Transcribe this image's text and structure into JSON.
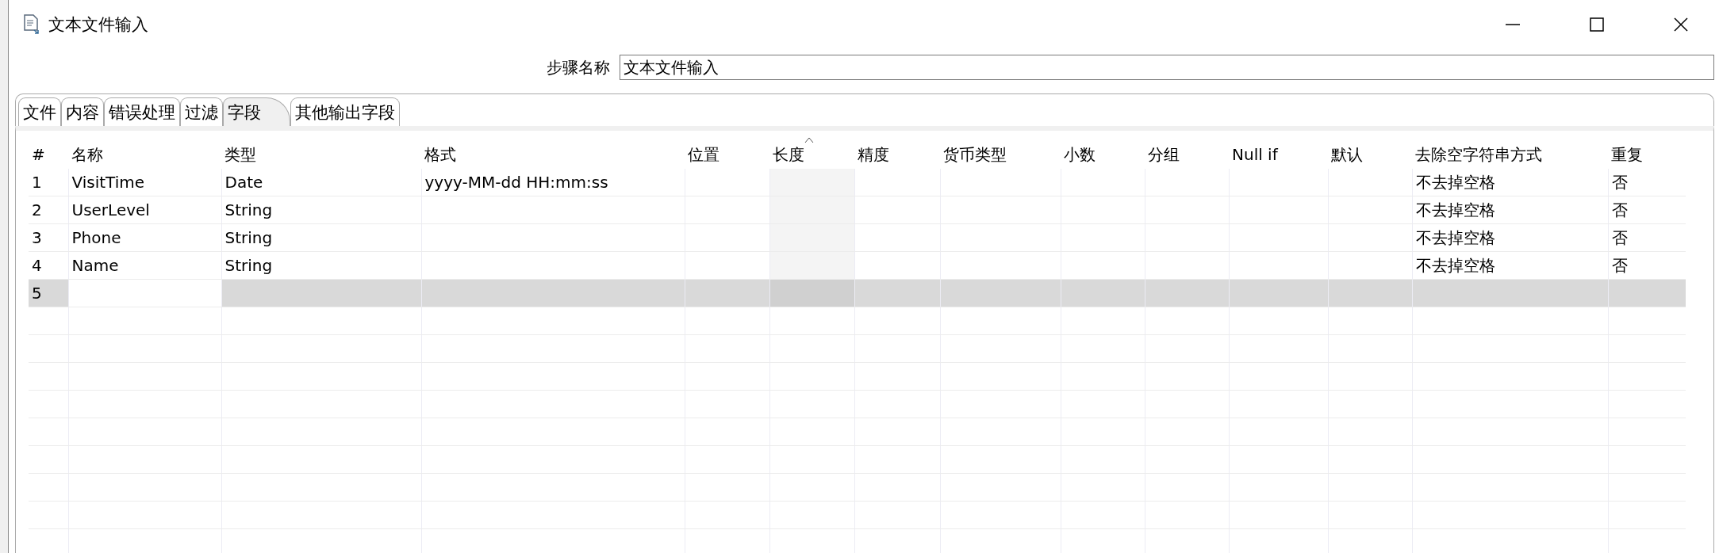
{
  "window": {
    "title": "文本文件输入"
  },
  "step_name": {
    "label": "步骤名称",
    "value": "文本文件输入"
  },
  "tabs": [
    {
      "label": "文件",
      "selected": false
    },
    {
      "label": "内容",
      "selected": false
    },
    {
      "label": "错误处理",
      "selected": false
    },
    {
      "label": "过滤",
      "selected": false
    },
    {
      "label": "字段",
      "selected": true
    },
    {
      "label": "其他输出字段",
      "selected": false
    }
  ],
  "table": {
    "columns": [
      {
        "label": "#"
      },
      {
        "label": "名称"
      },
      {
        "label": "类型"
      },
      {
        "label": "格式"
      },
      {
        "label": "位置"
      },
      {
        "label": "长度",
        "sorted": true
      },
      {
        "label": "精度"
      },
      {
        "label": "货币类型"
      },
      {
        "label": "小数"
      },
      {
        "label": "分组"
      },
      {
        "label": "Null if"
      },
      {
        "label": "默认"
      },
      {
        "label": "去除空字符串方式"
      },
      {
        "label": "重复"
      }
    ],
    "rows": [
      {
        "selected": false,
        "cells": [
          "1",
          "VisitTime",
          "Date",
          "yyyy-MM-dd HH:mm:ss",
          "",
          "",
          "",
          "",
          "",
          "",
          "",
          "",
          "不去掉空格",
          "否"
        ]
      },
      {
        "selected": false,
        "cells": [
          "2",
          "UserLevel",
          "String",
          "",
          "",
          "",
          "",
          "",
          "",
          "",
          "",
          "",
          "不去掉空格",
          "否"
        ]
      },
      {
        "selected": false,
        "cells": [
          "3",
          "Phone",
          "String",
          "",
          "",
          "",
          "",
          "",
          "",
          "",
          "",
          "",
          "不去掉空格",
          "否"
        ]
      },
      {
        "selected": false,
        "cells": [
          "4",
          "Name",
          "String",
          "",
          "",
          "",
          "",
          "",
          "",
          "",
          "",
          "",
          "不去掉空格",
          "否"
        ]
      },
      {
        "selected": true,
        "cells": [
          "5",
          "",
          "",
          "",
          "",
          "",
          "",
          "",
          "",
          "",
          "",
          "",
          "",
          ""
        ]
      }
    ]
  }
}
